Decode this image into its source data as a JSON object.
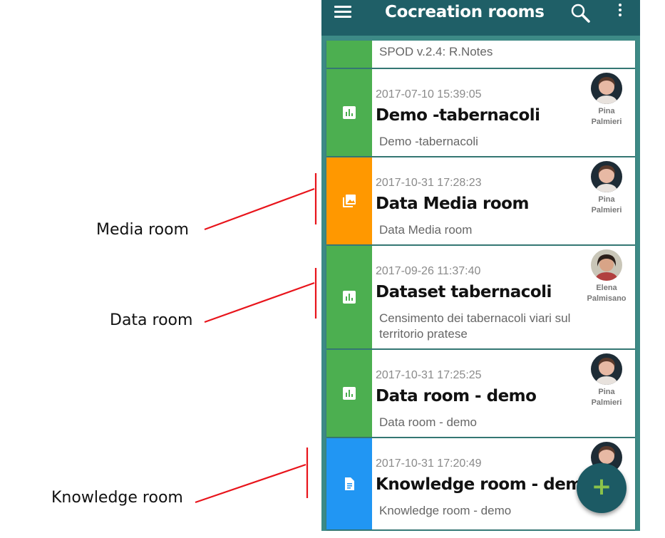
{
  "app": {
    "title": "Cocreation rooms",
    "header_color": "#1f5f67",
    "background_color": "#3d8a86"
  },
  "icons": {
    "menu": "menu-icon",
    "search": "search-icon",
    "more": "more-vertical-icon",
    "fab": "add-icon"
  },
  "partial_top_card": {
    "text": "SPOD v.2.4: R.Notes",
    "color": "#4caf50"
  },
  "rooms": [
    {
      "date": "2017-07-10 15:39:05",
      "name": "Demo -tabernacoli",
      "description": "Demo -tabernacoli",
      "author_first": "Pina",
      "author_last": "Palmieri",
      "type": "data",
      "icon": "chart-icon",
      "color": "#4caf50"
    },
    {
      "date": "2017-10-31 17:28:23",
      "name": "Data Media room",
      "description": "Data Media room",
      "author_first": "Pina",
      "author_last": "Palmieri",
      "type": "media",
      "icon": "image-icon",
      "color": "#ff9800"
    },
    {
      "date": "2017-09-26 11:37:40",
      "name": "Dataset tabernacoli",
      "description": "Censimento dei tabernacoli viari sul territorio pratese",
      "author_first": "Elena",
      "author_last": "Palmisano",
      "type": "data",
      "icon": "chart-icon",
      "color": "#4caf50"
    },
    {
      "date": "2017-10-31 17:25:25",
      "name": "Data room - demo",
      "description": "Data room - demo",
      "author_first": "Pina",
      "author_last": "Palmieri",
      "type": "data",
      "icon": "chart-icon",
      "color": "#4caf50"
    },
    {
      "date": "2017-10-31 17:20:49",
      "name": "Knowledge room - demo",
      "description": "Knowledge room - demo",
      "author_first": "",
      "author_last": "",
      "type": "knowledge",
      "icon": "document-icon",
      "color": "#2196f3"
    }
  ],
  "fab": {
    "label": "+",
    "color": "#8bc34a"
  },
  "annotations": [
    {
      "label": "Media room"
    },
    {
      "label": "Data room"
    },
    {
      "label": "Knowledge room"
    }
  ],
  "annotation_color": "#e8141b"
}
